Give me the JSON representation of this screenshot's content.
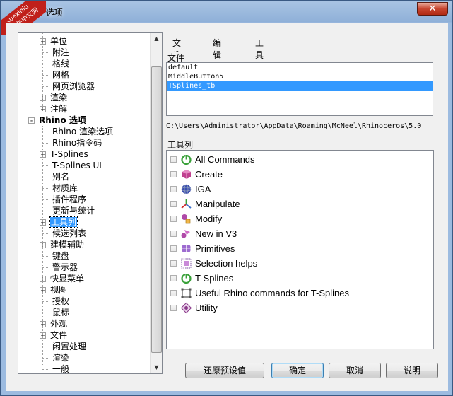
{
  "window": {
    "title": "hino 选项",
    "close_glyph": "✕"
  },
  "watermark": {
    "line1": "xuexiniu",
    "line2": "学犀牛中文网"
  },
  "tree": {
    "items": [
      {
        "label": "单位",
        "level": 2,
        "expander": "+"
      },
      {
        "label": "附注",
        "level": 2,
        "expander": ""
      },
      {
        "label": "格线",
        "level": 2,
        "expander": ""
      },
      {
        "label": "网格",
        "level": 2,
        "expander": ""
      },
      {
        "label": "网页浏览器",
        "level": 2,
        "expander": ""
      },
      {
        "label": "渲染",
        "level": 2,
        "expander": "+"
      },
      {
        "label": "注解",
        "level": 2,
        "expander": "+"
      },
      {
        "label": "Rhino 选项",
        "level": 1,
        "expander": "-",
        "bold": true
      },
      {
        "label": "Rhino 渲染选项",
        "level": 2,
        "expander": ""
      },
      {
        "label": "Rhino指令码",
        "level": 2,
        "expander": ""
      },
      {
        "label": "T-Splines",
        "level": 2,
        "expander": "+"
      },
      {
        "label": "T-Splines UI",
        "level": 2,
        "expander": ""
      },
      {
        "label": "别名",
        "level": 2,
        "expander": ""
      },
      {
        "label": "材质库",
        "level": 2,
        "expander": ""
      },
      {
        "label": "插件程序",
        "level": 2,
        "expander": ""
      },
      {
        "label": "更新与统计",
        "level": 2,
        "expander": ""
      },
      {
        "label": "工具列",
        "level": 2,
        "expander": "+",
        "selected": true
      },
      {
        "label": "候选列表",
        "level": 2,
        "expander": ""
      },
      {
        "label": "建模辅助",
        "level": 2,
        "expander": "+"
      },
      {
        "label": "键盘",
        "level": 2,
        "expander": ""
      },
      {
        "label": "警示器",
        "level": 2,
        "expander": ""
      },
      {
        "label": "快显菜单",
        "level": 2,
        "expander": "+"
      },
      {
        "label": "视图",
        "level": 2,
        "expander": "+"
      },
      {
        "label": "授权",
        "level": 2,
        "expander": ""
      },
      {
        "label": "鼠标",
        "level": 2,
        "expander": ""
      },
      {
        "label": "外观",
        "level": 2,
        "expander": "+"
      },
      {
        "label": "文件",
        "level": 2,
        "expander": "+"
      },
      {
        "label": "闲置处理",
        "level": 2,
        "expander": ""
      },
      {
        "label": "渲染",
        "level": 2,
        "expander": ""
      },
      {
        "label": "一般",
        "level": 2,
        "expander": ""
      }
    ]
  },
  "menu": {
    "file": "文件(F)",
    "edit": "编辑(E)",
    "tools": "工具(T)"
  },
  "files_group": {
    "label": "文件",
    "items": [
      "default",
      "MiddleButton5",
      "TSplines_tb"
    ],
    "selected_index": 2,
    "path": "C:\\Users\\Administrator\\AppData\\Roaming\\McNeel\\Rhinoceros\\5.0"
  },
  "toolbars_group": {
    "label": "工具列",
    "items": [
      {
        "label": "All Commands",
        "icon": "power-icon",
        "color": "#3aa13a"
      },
      {
        "label": "Create",
        "icon": "cube-icon",
        "color": "#c0408f"
      },
      {
        "label": "IGA",
        "icon": "sphere-icon",
        "color": "#3c4fb0"
      },
      {
        "label": "Manipulate",
        "icon": "axes-icon",
        "color": "#3b6fc9"
      },
      {
        "label": "Modify",
        "icon": "modify-icon",
        "color": "#b04aa8"
      },
      {
        "label": "New in V3",
        "icon": "new-icon",
        "color": "#b04aa8"
      },
      {
        "label": "Primitives",
        "icon": "primitive-icon",
        "color": "#9d6bd0"
      },
      {
        "label": "Selection helps",
        "icon": "grid-select-icon",
        "color": "#7a4fa0"
      },
      {
        "label": "T-Splines",
        "icon": "power-icon",
        "color": "#3aa13a"
      },
      {
        "label": "Useful Rhino commands for T-Splines",
        "icon": "frame-icon",
        "color": "#555555"
      },
      {
        "label": "Utility",
        "icon": "utility-icon",
        "color": "#8a3a8a"
      }
    ]
  },
  "buttons": {
    "restore": "还原预设值",
    "ok": "确定",
    "cancel": "取消",
    "help": "说明"
  }
}
